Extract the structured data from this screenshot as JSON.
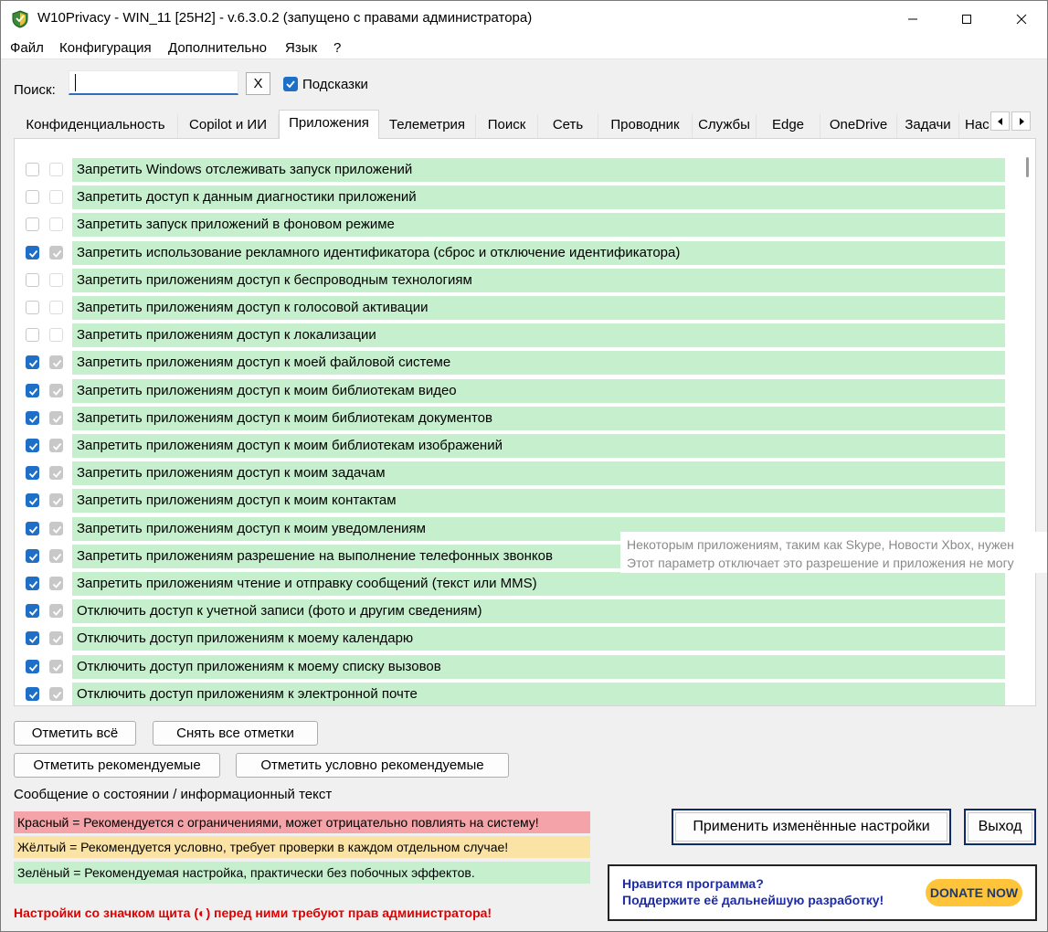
{
  "window": {
    "title": "W10Privacy - WIN_11 [25H2] - v.6.3.0.2 (запущено с правами администратора)"
  },
  "menu": [
    "Файл",
    "Конфигурация",
    "Дополнительно",
    "Язык",
    "?"
  ],
  "search": {
    "label": "Поиск:",
    "value": "",
    "clear_label": "X",
    "hints_label": "Подсказки",
    "hints_checked": true
  },
  "tabs": [
    {
      "label": "Конфиденциальность",
      "active": false
    },
    {
      "label": "Copilot и ИИ",
      "active": false
    },
    {
      "label": "Приложения",
      "active": true
    },
    {
      "label": "Телеметрия",
      "active": false
    },
    {
      "label": "Поиск",
      "active": false
    },
    {
      "label": "Сеть",
      "active": false
    },
    {
      "label": "Проводник",
      "active": false
    },
    {
      "label": "Службы",
      "active": false
    },
    {
      "label": "Edge",
      "active": false
    },
    {
      "label": "OneDrive",
      "active": false
    },
    {
      "label": "Задачи",
      "active": false
    },
    {
      "label": "Нас",
      "active": false
    }
  ],
  "settings": [
    {
      "label": "Запретить Windows отслеживать запуск приложений",
      "checked": false
    },
    {
      "label": "Запретить доступ к данным диагностики приложений",
      "checked": false
    },
    {
      "label": "Запретить запуск приложений в фоновом режиме",
      "checked": false
    },
    {
      "label": "Запретить использование рекламного идентификатора (сброс и отключение идентификатора)",
      "checked": true
    },
    {
      "label": "Запретить приложениям доступ к беспроводным технологиям",
      "checked": false
    },
    {
      "label": "Запретить приложениям доступ к голосовой активации",
      "checked": false
    },
    {
      "label": "Запретить приложениям доступ к локализации",
      "checked": false
    },
    {
      "label": "Запретить приложениям доступ к моей файловой системе",
      "checked": true
    },
    {
      "label": "Запретить приложениям доступ к моим библиотекам видео",
      "checked": true
    },
    {
      "label": "Запретить приложениям доступ к моим библиотекам документов",
      "checked": true
    },
    {
      "label": "Запретить приложениям доступ к моим библиотекам изображений",
      "checked": true
    },
    {
      "label": "Запретить приложениям доступ к моим задачам",
      "checked": true
    },
    {
      "label": "Запретить приложениям доступ к моим контактам",
      "checked": true
    },
    {
      "label": "Запретить приложениям доступ к моим уведомлениям",
      "checked": true
    },
    {
      "label": "Запретить приложениям разрешение на выполнение телефонных звонков",
      "checked": true
    },
    {
      "label": "Запретить приложениям чтение и отправку сообщений (текст или MMS)",
      "checked": true
    },
    {
      "label": "Отключить доступ к учетной записи (фото и другим сведениям)",
      "checked": true
    },
    {
      "label": "Отключить доступ приложениям к моему календарю",
      "checked": true
    },
    {
      "label": "Отключить доступ приложениям к моему списку вызовов",
      "checked": true
    },
    {
      "label": "Отключить доступ приложениям к электронной почте",
      "checked": true
    }
  ],
  "tooltip": {
    "line1": "Некоторым приложениям, таким как Skype, Новости Xbox, нужен",
    "line2": "Этот параметр отключает это разрешение и приложения не могу"
  },
  "buttons": {
    "check_all": "Отметить всё",
    "uncheck_all": "Снять все отметки",
    "check_recommended": "Отметить рекомендуемые",
    "check_conditional": "Отметить условно рекомендуемые",
    "apply": "Применить изменённые настройки",
    "exit": "Выход"
  },
  "status": {
    "label": "Сообщение о состоянии / информационный текст",
    "legend_red": "Красный = Рекомендуется с ограничениями, может отрицательно повлиять на систему!",
    "legend_yellow": "Жёлтый = Рекомендуется условно, требует проверки в каждом отдельном случае!",
    "legend_green": "Зелёный = Рекомендуемая настройка, практически без побочных эффектов.",
    "admin_note": "Настройки со значком щита (◐) перед ними требуют прав администратора!"
  },
  "donate": {
    "line1": "Нравится программа?",
    "line2": "Поддержите её дальнейшую разработку!",
    "button": "DONATE NOW"
  },
  "colors": {
    "green_row": "#c6efce",
    "red_legend": "#f4a3a8",
    "yellow_legend": "#fbe3a6",
    "green_legend": "#c6efce",
    "accent": "#1f6fc6",
    "admin_note": "#e00000",
    "donate_text": "#1c2ba8",
    "donate_button": "#ffc439"
  }
}
